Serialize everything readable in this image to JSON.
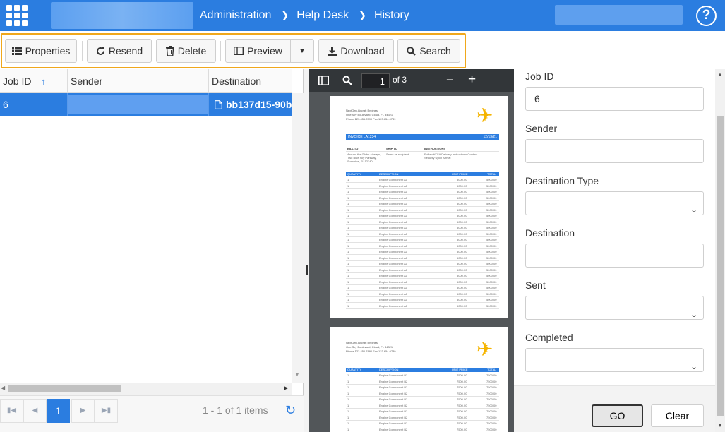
{
  "header": {
    "breadcrumbs": [
      "Administration",
      "Help Desk",
      "History"
    ],
    "help_icon": "question-circle-icon"
  },
  "toolbar": {
    "properties": "Properties",
    "resend": "Resend",
    "delete": "Delete",
    "preview": "Preview",
    "download": "Download",
    "search": "Search"
  },
  "grid": {
    "columns": [
      "Job ID",
      "Sender",
      "Destination"
    ],
    "sort": {
      "column": "Job ID",
      "direction": "ascending"
    },
    "rows": [
      {
        "job_id": "6",
        "sender": "",
        "destination": "bb137d15-90b"
      }
    ],
    "pager": {
      "current_page": "1",
      "items_info": "1 - 1 of 1 items"
    }
  },
  "pdf_viewer": {
    "page_input": "1",
    "page_count_label": "of 3",
    "page1": {
      "company": "NextGen Aircraft Engines",
      "address": "One Sky Boulevard, Cloud, FL 34321",
      "phone": "Phone 123.456.7890  Fax 123.654.0789",
      "invoice": "INVOICE LA1234",
      "date": "12/13/21",
      "bill_to_label": "BILL TO",
      "ship_to_label": "SHIP TO",
      "instructions_label": "INSTRUCTIONS",
      "bill_to": "Around the Globe Airways, Two Blue Sky Parkway, Sunshine, FL 12340",
      "ship_to": "Same as recipient",
      "instructions": "Follow HTSA Delivery Instructions Contact Security Upon Arrival",
      "table_headers": [
        "QUANTITY",
        "DESCRIPTION",
        "UNIT PRICE",
        "TOTAL"
      ],
      "row": {
        "qty": "1",
        "desc": "Engine Component A1",
        "unit": "5000.00",
        "total": "5000.00"
      }
    },
    "page2": {
      "company": "NextGen Aircraft Engines",
      "address": "One Sky Boulevard, Cloud, FL 34321",
      "phone": "Phone 123.456.7890  Fax 123.654.0789",
      "table_headers": [
        "QUANTITY",
        "DESCRIPTION",
        "UNIT PRICE",
        "TOTAL"
      ],
      "row": {
        "qty": "1",
        "desc": "Engine Component B2",
        "unit": "7500.00",
        "total": "7500.00"
      }
    }
  },
  "filter": {
    "job_id_label": "Job ID",
    "job_id_value": "6",
    "sender_label": "Sender",
    "destination_type_label": "Destination Type",
    "destination_label": "Destination",
    "sent_label": "Sent",
    "completed_label": "Completed",
    "go_label": "GO",
    "clear_label": "Clear"
  },
  "colors": {
    "accent": "#2b7de0",
    "toolbar_highlight": "#f0a81c",
    "plane": "#f5b400"
  }
}
